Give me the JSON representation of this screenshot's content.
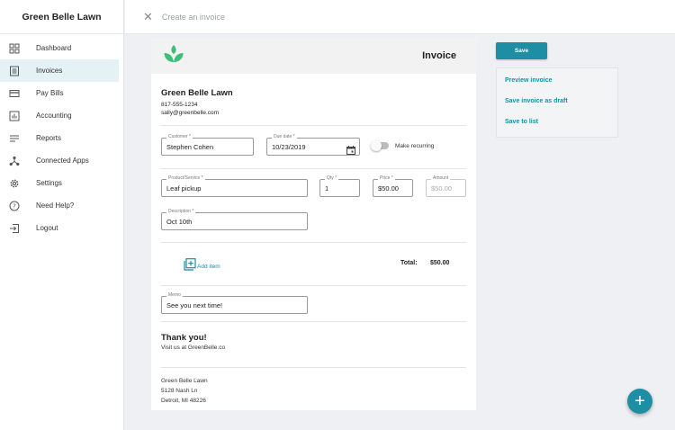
{
  "sidebar": {
    "brand": "Green Belle Lawn",
    "items": [
      {
        "label": "Dashboard",
        "icon": "dashboard-icon",
        "active": false
      },
      {
        "label": "Invoices",
        "icon": "invoice-icon",
        "active": true
      },
      {
        "label": "Pay Bills",
        "icon": "credit-card-icon",
        "active": false
      },
      {
        "label": "Accounting",
        "icon": "chart-icon",
        "active": false
      },
      {
        "label": "Reports",
        "icon": "reports-icon",
        "active": false
      },
      {
        "label": "Connected Apps",
        "icon": "connected-apps-icon",
        "active": false
      },
      {
        "label": "Settings",
        "icon": "gear-icon",
        "active": false
      },
      {
        "label": "Need Help?",
        "icon": "help-icon",
        "active": false
      },
      {
        "label": "Logout",
        "icon": "logout-icon",
        "active": false
      }
    ]
  },
  "topbar": {
    "title": "Create an invoice",
    "close_icon": "close-icon"
  },
  "invoice": {
    "title": "Invoice",
    "logo_icon": "leaf-logo-icon",
    "company": {
      "name": "Green Belle Lawn",
      "phone": "817-555-1234",
      "email": "sally@greenbelle.com"
    },
    "customer": {
      "label": "Customer *",
      "value": "Stephen Cohen"
    },
    "due_date": {
      "label": "Due date *",
      "value": "10/23/2019"
    },
    "recurring_label": "Make recurring",
    "product": {
      "label": "Product/Service *",
      "value": "Leaf pickup"
    },
    "qty": {
      "label": "Qty *",
      "value": "1"
    },
    "price": {
      "label": "Price *",
      "value": "$50.00"
    },
    "amount": {
      "label": "Amount",
      "value": "$50.00"
    },
    "description": {
      "label": "Description *",
      "value": "Oct 10th"
    },
    "add_item_label": "Add item",
    "total_label": "Total:",
    "total_value": "$50.00",
    "memo": {
      "label": "Memo",
      "value": "See you next time!"
    },
    "thanks": "Thank you!",
    "visit": "Visit us at GreenBelle.co",
    "footer": {
      "name": "Green Belle Lawn",
      "street": "5128 Nash Ln",
      "city": "Detroit, MI 48226"
    }
  },
  "actions": {
    "save_label": "Save",
    "preview_label": "Preview invoice",
    "draft_label": "Save invoice as draft",
    "list_label": "Save to list"
  },
  "colors": {
    "accent": "#1d8ea4",
    "logo_green": "#3bbf7a",
    "active_bg": "#e4f2f6"
  }
}
